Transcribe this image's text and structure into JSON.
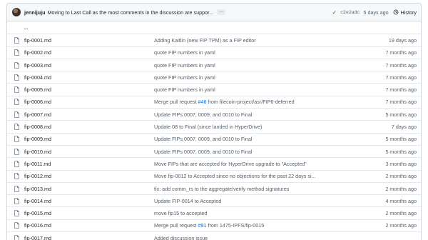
{
  "commit": {
    "author": "jennijuju",
    "message": "Moving to Last Call as the most comments in the discussion are suppor...",
    "more": "...",
    "sha": "c2e2adc",
    "age": "5 days ago",
    "history_label": "History"
  },
  "parent_dir": "..",
  "files": [
    {
      "name": "fip-0001.md",
      "msg": "Adding Kaitlin (new FIP TPM) as a FIP editor",
      "age": "19 days ago"
    },
    {
      "name": "fip-0002.md",
      "msg": "quote FIP numbers in yaml",
      "age": "7 months ago"
    },
    {
      "name": "fip-0003.md",
      "msg": "quote FIP numbers in yaml",
      "age": "7 months ago"
    },
    {
      "name": "fip-0004.md",
      "msg": "quote FIP numbers in yaml",
      "age": "7 months ago"
    },
    {
      "name": "fip-0005.md",
      "msg": "quote FIP numbers in yaml",
      "age": "7 months ago"
    },
    {
      "name": "fip-0006.md",
      "msg_pre": "Merge pull request ",
      "msg_link": "#46",
      "msg_post": " from filecoin-project/asr/FIP6-deferred",
      "age": "7 months ago"
    },
    {
      "name": "fip-0007.md",
      "msg": "Update FIPs 0007, 0009, and 0010 to Final",
      "age": "5 months ago"
    },
    {
      "name": "fip-0008.md",
      "msg": "Update 08 to Final (since landed in HyperDrive)",
      "age": "7 days ago"
    },
    {
      "name": "fip-0009.md",
      "msg": "Update FIPs 0007, 0009, and 0010 to Final",
      "age": "5 months ago"
    },
    {
      "name": "fip-0010.md",
      "msg": "Update FIPs 0007, 0009, and 0010 to Final",
      "age": "5 months ago"
    },
    {
      "name": "fip-0011.md",
      "msg": "Move FIPs that are accepted for HyperDrive upgrade to \"Accepted\"",
      "age": "3 months ago"
    },
    {
      "name": "fip-0012.md",
      "msg": "Move fip-0012 to Accepted since no objections for the past 22 days si...",
      "age": "2 months ago"
    },
    {
      "name": "fip-0013.md",
      "msg": "fix: add comm_rs to the aggregate/verify method signatures",
      "age": "2 months ago"
    },
    {
      "name": "fip-0014.md",
      "msg": "Update FIP-0014 to Accepted",
      "age": "4 months ago"
    },
    {
      "name": "fip-0015.md",
      "msg": "move fip15 to accepted",
      "age": "2 months ago"
    },
    {
      "name": "fip-0016.md",
      "msg_pre": "Merge pull request ",
      "msg_link": "#91",
      "msg_post": " from 1475-IPFS/fip-0015",
      "age": "2 months ago"
    },
    {
      "name": "fip-0017.md",
      "msg": "Added discussion issue",
      "age": ""
    }
  ]
}
